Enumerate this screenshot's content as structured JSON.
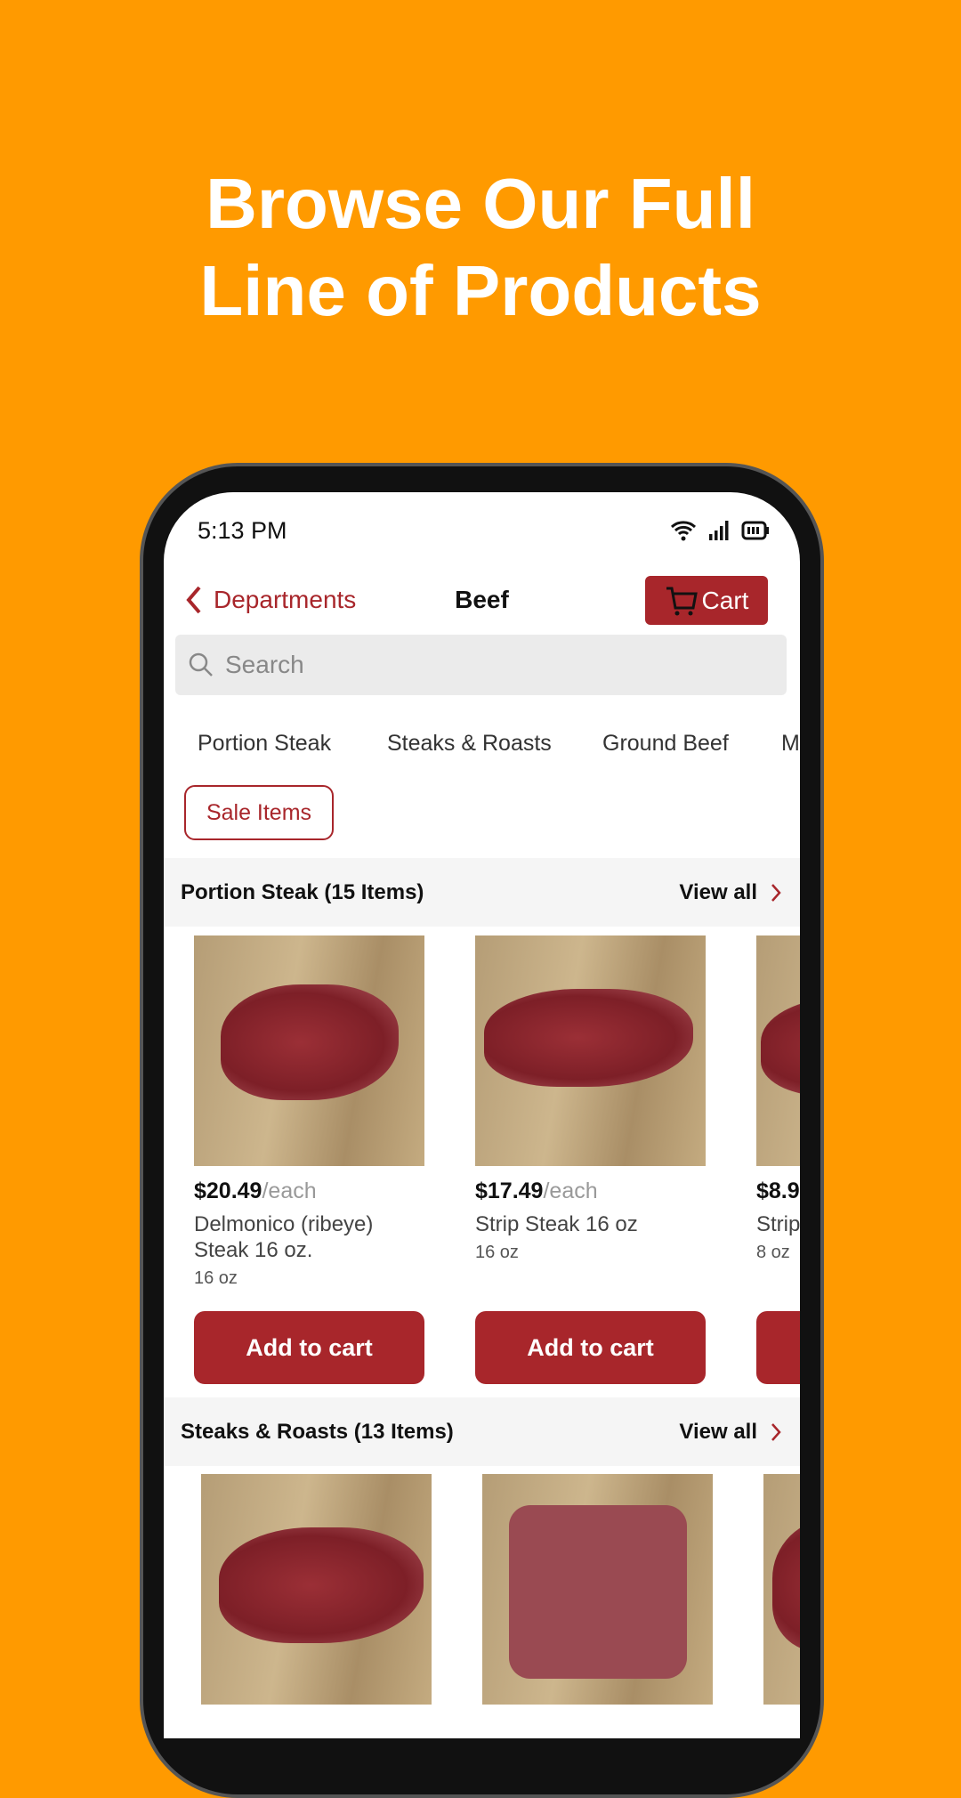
{
  "headline": {
    "line1": "Browse Our Full",
    "line2": "Line of Products"
  },
  "status": {
    "time": "5:13 PM"
  },
  "header": {
    "back_label": "Departments",
    "title": "Beef",
    "cart_label": "Cart"
  },
  "search": {
    "placeholder": "Search"
  },
  "tabs": [
    "Portion Steak",
    "Steaks & Roasts",
    "Ground Beef",
    "M"
  ],
  "sale_label": "Sale Items",
  "colors": {
    "brand": "#A8262B",
    "background": "#FF9A00"
  },
  "sections": [
    {
      "title": "Portion Steak (15 Items)",
      "view_all": "View all",
      "products": [
        {
          "price": "$20.49",
          "unit": "/each",
          "name": "Delmonico (ribeye) Steak 16 oz.",
          "size": "16 oz",
          "button": "Add to cart"
        },
        {
          "price": "$17.49",
          "unit": "/each",
          "name": "Strip Steak 16 oz",
          "size": "16 oz",
          "button": "Add to cart"
        },
        {
          "price": "$8.9",
          "unit": "",
          "name": "Strip",
          "size": "8 oz",
          "button": ""
        }
      ]
    },
    {
      "title": "Steaks & Roasts (13 Items)",
      "view_all": "View all"
    }
  ]
}
